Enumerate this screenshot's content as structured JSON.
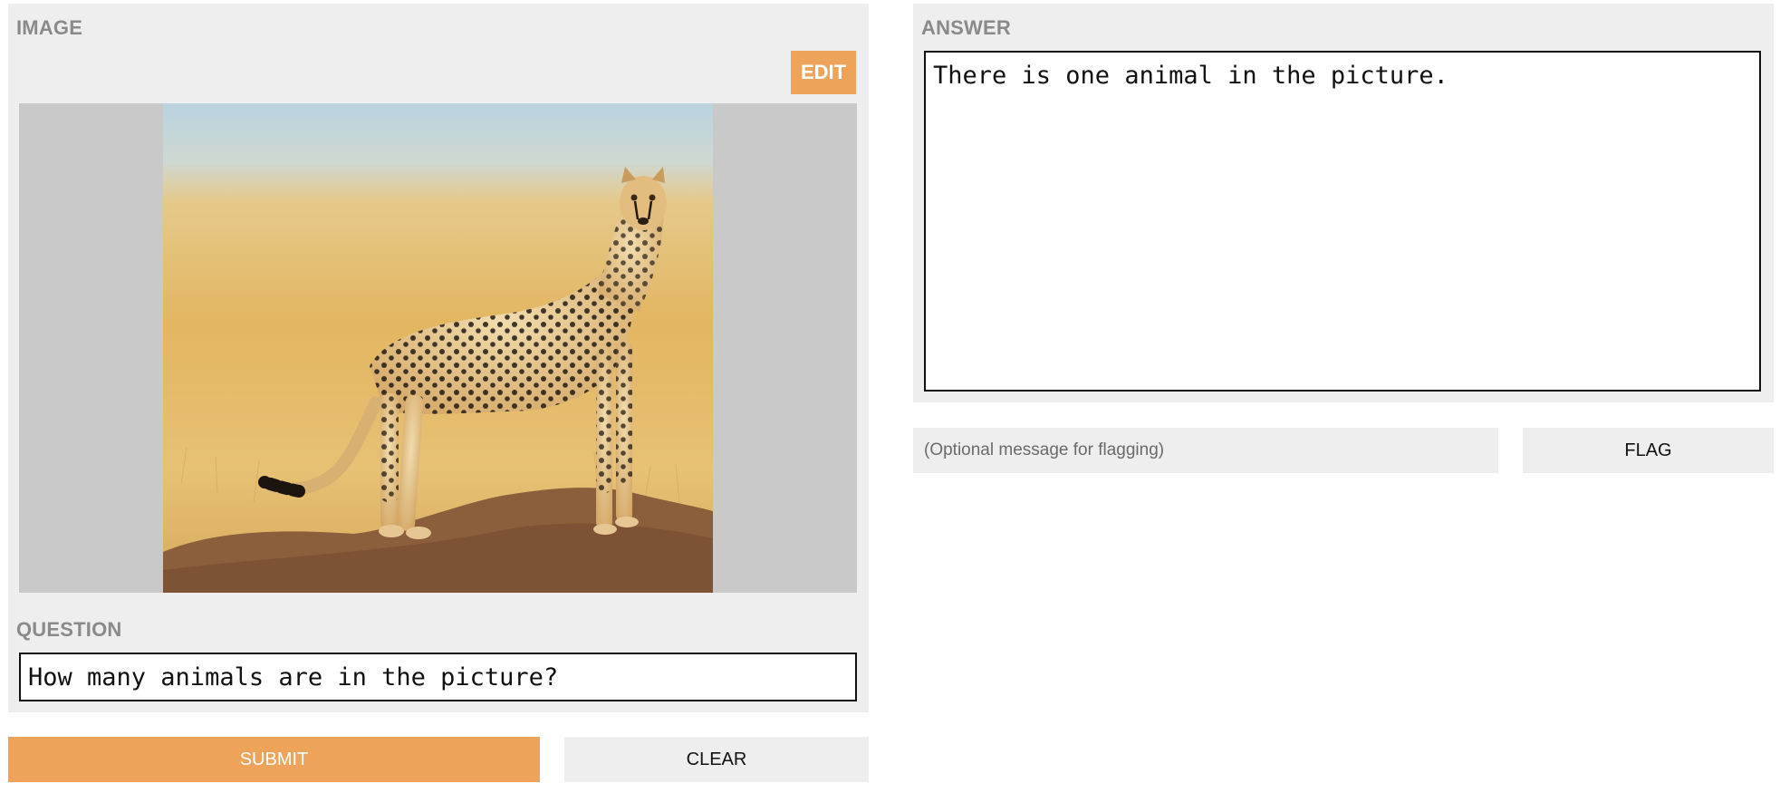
{
  "image_section": {
    "label": "IMAGE",
    "edit_label": "EDIT",
    "photo_subject": "cheetah-standing-on-termite-mound"
  },
  "question_section": {
    "label": "QUESTION",
    "value": "How many animals are in the picture?"
  },
  "actions": {
    "submit_label": "SUBMIT",
    "clear_label": "CLEAR"
  },
  "answer_section": {
    "label": "ANSWER",
    "value": "There is one animal in the picture."
  },
  "flag": {
    "placeholder": "(Optional message for flagging)",
    "button_label": "FLAG"
  },
  "colors": {
    "accent": "#eda35a",
    "panel_bg": "#eeeeee",
    "image_frame_bg": "#c9c9c9",
    "label_text": "#8a8a8a"
  }
}
